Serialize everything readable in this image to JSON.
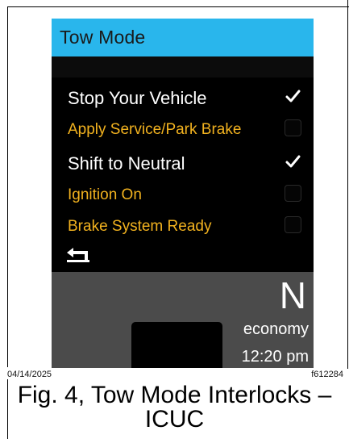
{
  "screen": {
    "title": "Tow Mode",
    "items": [
      {
        "label": "Stop Your Vehicle",
        "checked": true
      },
      {
        "label": "Apply Service/Park Brake",
        "checked": false
      },
      {
        "label": "Shift to Neutral",
        "checked": true
      },
      {
        "label": "Ignition On",
        "checked": false
      },
      {
        "label": "Brake System Ready",
        "checked": false
      }
    ],
    "back_icon": "back-arrow-icon",
    "gear": "N",
    "mode": "economy",
    "time": "12:20 pm"
  },
  "footer": {
    "date": "04/14/2025",
    "code": "f612284"
  },
  "caption": {
    "line1": "Fig. 4, Tow Mode Interlocks –",
    "line2": "ICUC"
  },
  "colors": {
    "title_bar": "#29b6ec",
    "screen_bg": "#000000",
    "pending_text": "#f2b21f",
    "done_text": "#ffffff",
    "lower_panel": "#4b4b4b"
  }
}
